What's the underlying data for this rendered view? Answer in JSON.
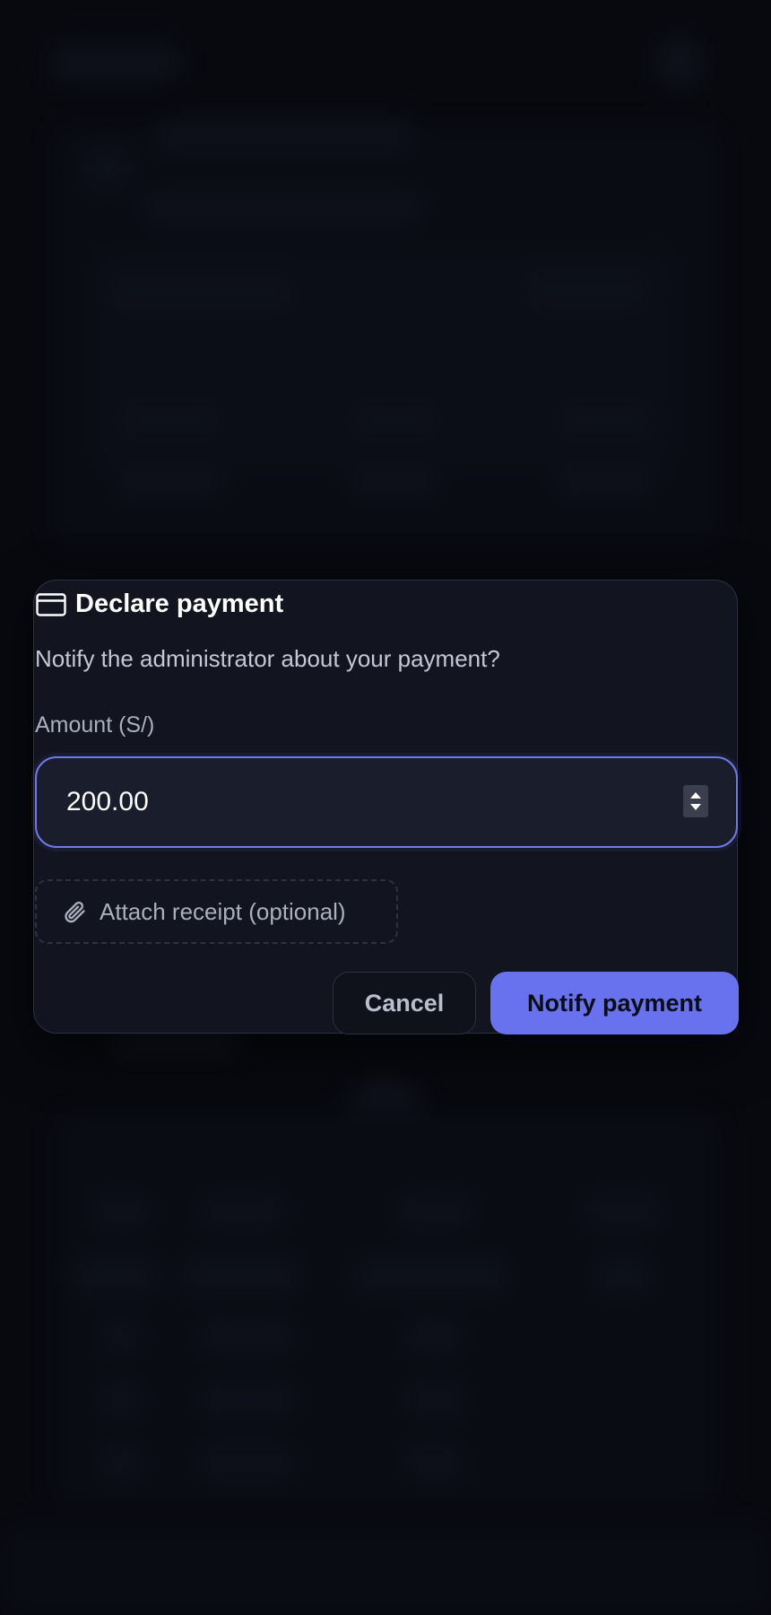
{
  "dialog": {
    "title": "Declare payment",
    "title_icon": "credit-card-icon",
    "description": "Notify the administrator about your payment?",
    "amount_label": "Amount (S/)",
    "amount_value": "200.00",
    "attach_label": "Attach receipt (optional)",
    "attach_icon": "paperclip-icon",
    "cancel_label": "Cancel",
    "submit_label": "Notify payment"
  },
  "colors": {
    "accent": "#6872ee",
    "focus_border": "#6f78e8",
    "dialog_bg": "#121520",
    "page_bg": "#0a0c12"
  }
}
